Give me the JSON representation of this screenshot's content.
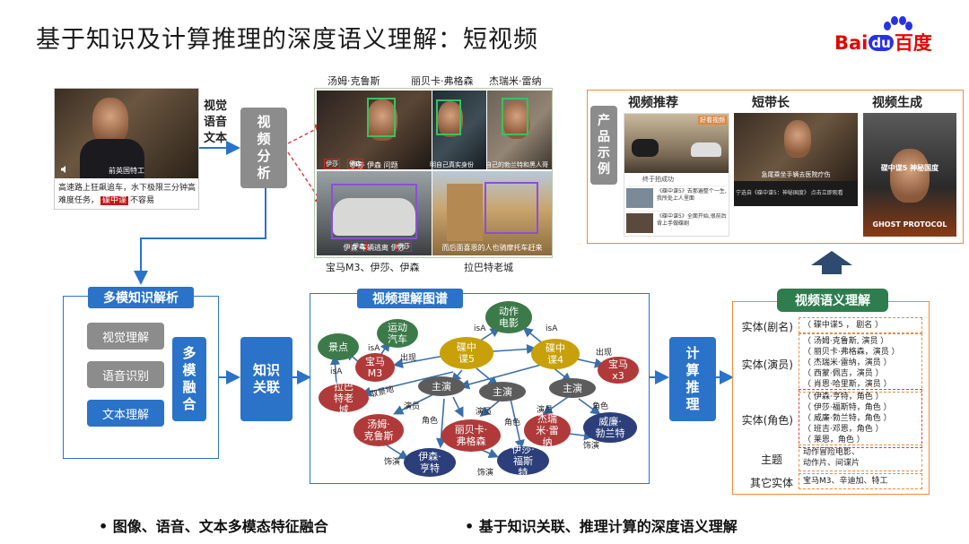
{
  "title": "基于知识及计算推理的深度语义理解：短视频",
  "logo": {
    "bai": "Bai",
    "du": "du",
    "baidu": "百度"
  },
  "source_video": {
    "subtitle": "前英国特工",
    "caption": "高速路上狂飙追车，水下极限三分钟高难度任务，",
    "caption_tag": "碟中谍",
    "caption_end": "不容易"
  },
  "modalities": {
    "line1": "视觉",
    "line2": "语音",
    "line3": "文本"
  },
  "video_analysis": "视频分析",
  "faces": {
    "names": [
      "汤姆·克鲁斯",
      "丽贝卡·弗格森",
      "杰瑞米·雷纳"
    ],
    "subs": [
      "伊莎  伊森  问题",
      "明自己真实身份",
      "自己的勃兰特和黑人哥"
    ],
    "tags1": [
      "伊莎",
      "伊森"
    ]
  },
  "objects": {
    "names": [
      "宝马M3、伊莎、伊森",
      "拉巴特老城"
    ],
    "subs": [
      "伊森  车辆逃离  伊莎",
      "而后面喜恩的人也骑摩托车赶来"
    ],
    "tags2": [
      "伊森",
      "伊莎"
    ]
  },
  "mm_fusion": {
    "header": "多模知识解析",
    "items": [
      "视觉理解",
      "语音识别",
      "文本理解"
    ],
    "fusion": "多模融合"
  },
  "knowledge_link": "知识关联",
  "graph": {
    "header": "视频理解图谱",
    "nodes": {
      "scenic": "景点",
      "sport_car": "运动汽车",
      "action_movie": "动作电影",
      "bmw": "宝马M3",
      "mi5": "碟中谍5",
      "mi4": "碟中谍4",
      "bmw_x3": "宝马x3",
      "rabat": "拉巴特老城",
      "lead1": "主演",
      "lead2": "主演",
      "lead3": "主演",
      "tom": "汤姆·克鲁斯",
      "rebecca": "丽贝卡·弗格森",
      "jeremy": "杰瑞米·雷纳",
      "william": "威廉·勃兰特",
      "ethan": "伊森·亨特",
      "ilsa": "伊莎·福斯特"
    },
    "edges": {
      "isA1": "isA",
      "isA2": "isA",
      "isA3": "isA",
      "isA4": "isA",
      "appear1": "出现",
      "appear2": "出现",
      "location": "取景地",
      "star1": "演员",
      "star2": "演员",
      "star3": "演员",
      "role1": "角色",
      "role2": "角色",
      "role3": "角色",
      "act1": "饰演",
      "act2": "饰演",
      "act3": "饰演"
    }
  },
  "compute_reason": "计算推理",
  "product": {
    "label": "产品示例",
    "cols": [
      "视频推荐",
      "短带长",
      "视频生成"
    ],
    "rec_badge": "好看视频",
    "rec_caption": "终于拍成功",
    "rec_items": [
      "《碟中谍5》去那遍整个一生,我所处上人里面",
      "《碟中谍5》全面开始,很前后背上手做碟剧"
    ],
    "short_sub": "急尾乘坐手辆去医院疗伤",
    "short_bar": "宁选自《碟中谍5：神秘国度》 点击立即观看",
    "gen_line1": "碟中谍5 神秘国度",
    "gen_line2": "GHOST PROTOCOL"
  },
  "semantic": {
    "header": "视频语义理解",
    "drama_label": "实体(剧名)",
    "drama": "（ 碟中谍5 ， 剧名 ）",
    "actor_label": "实体(演员)",
    "actors": [
      "（ 汤姆·克鲁斯, 演员 ）",
      "（ 丽贝卡·弗格森，演员 ）",
      "（ 杰瑞米·雷纳，演员 ）",
      "（ 西蒙·佩吉，演员 ）",
      "（ 肖恩·哈里斯，演员 ）"
    ],
    "role_label": "实体(角色)",
    "roles": [
      "（ 伊森·亨特，角色 ）",
      "（ 伊莎·福斯特，角色 ）",
      "（ 威廉·勃兰特，角色 ）",
      "（ 班吉·邓恩，角色 ）",
      "（ 莱恩，角色 ）"
    ],
    "theme_label": "主题",
    "themes": [
      "动作冒险电影、",
      "动作片、间谍片"
    ],
    "other_label": "其它实体",
    "others": "宝马M3、辛迪加、特工"
  },
  "bullets": [
    "• 图像、语音、文本多模态特征融合",
    "• 基于知识关联、推理计算的深度语义理解"
  ],
  "colors": {
    "blue": "#2a73c9",
    "orange": "#f08a3c",
    "red": "#e10602",
    "green": "#2e7d4f"
  }
}
